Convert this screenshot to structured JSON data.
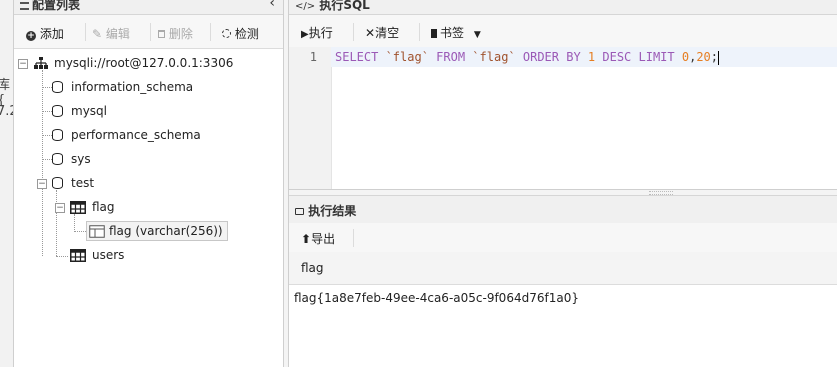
{
  "left_edge": {
    "partial_text_1": "库{",
    "partial_text_2": "7.2"
  },
  "config_panel": {
    "title": "配置列表",
    "collapse_glyph": "‹",
    "toolbar": {
      "add": "添加",
      "edit": "编辑",
      "delete": "删除",
      "check": "检测"
    },
    "tree": {
      "root": "mysqli://root@127.0.0.1:3306",
      "databases": [
        "information_schema",
        "mysql",
        "performance_schema",
        "sys",
        "test"
      ],
      "test_tables": [
        "flag",
        "users"
      ],
      "flag_columns": [
        "flag (varchar(256))"
      ]
    }
  },
  "sql_panel": {
    "title": "执行SQL",
    "toolbar": {
      "run": "执行",
      "clear": "清空",
      "bookmark": "书签"
    },
    "editor": {
      "line_number": "1",
      "tokens": [
        {
          "t": "SELECT ",
          "c": "kw"
        },
        {
          "t": "`flag`",
          "c": "id"
        },
        {
          "t": " FROM ",
          "c": "kw"
        },
        {
          "t": "`flag`",
          "c": "id"
        },
        {
          "t": " ORDER BY ",
          "c": "kw"
        },
        {
          "t": "1",
          "c": "num"
        },
        {
          "t": " DESC LIMIT ",
          "c": "kw"
        },
        {
          "t": "0",
          "c": "num"
        },
        {
          "t": ",",
          "c": "pun"
        },
        {
          "t": "20",
          "c": "num"
        },
        {
          "t": ";",
          "c": "pun"
        }
      ]
    }
  },
  "result_panel": {
    "title": "执行结果",
    "toolbar": {
      "export": "导出"
    },
    "columns": [
      "flag"
    ],
    "rows": [
      [
        "flag{1a8e7feb-49ee-4ca6-a05c-9f064d76f1a0}"
      ]
    ]
  },
  "colors": {
    "keyword": "#9b59b6",
    "identifier": "#a0522d",
    "number": "#e67e22"
  }
}
